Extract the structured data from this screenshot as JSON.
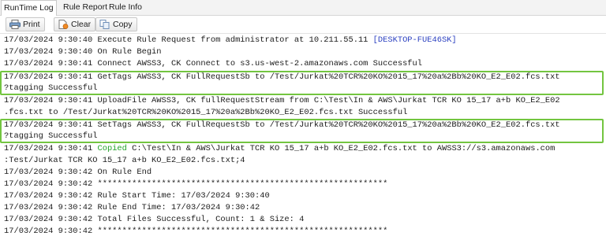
{
  "tabs": [
    {
      "label": "RunTime Log",
      "active": true
    },
    {
      "label": "Rule Report",
      "active": false
    },
    {
      "label": "Rule Info",
      "active": false
    }
  ],
  "toolbar": {
    "print_label": "Print",
    "clear_label": "Clear",
    "copy_label": "Copy"
  },
  "colors": {
    "highlight_border": "#73c540",
    "link_blue": "#2a3fc0",
    "copied_green": "#21a327"
  },
  "log": {
    "lines": [
      {
        "text": "17/03/2024 9:30:40 Execute Rule Request from administrator at 10.211.55.11 ",
        "suffix": "[DESKTOP-FUE46SK]"
      },
      {
        "text": "17/03/2024 9:30:40 On Rule Begin"
      },
      {
        "text": "17/03/2024 9:30:41 Connect AWSS3, CK Connect to s3.us-west-2.amazonaws.com Successful"
      },
      {
        "text": "17/03/2024 9:30:41 GetTags AWSS3, CK FullRequestSb to /Test/Jurkat%20TCR%20KO%2015_17%20a%2Bb%20KO_E2_E02.fcs.txt"
      },
      {
        "text": "?tagging Successful"
      },
      {
        "text": "17/03/2024 9:30:41 UploadFile AWSS3, CK fullRequestStream from C:\\Test\\In & AWS\\Jurkat TCR KO 15_17 a+b KO_E2_E02"
      },
      {
        "text": ".fcs.txt to /Test/Jurkat%20TCR%20KO%2015_17%20a%2Bb%20KO_E2_E02.fcs.txt Successful"
      },
      {
        "text": "17/03/2024 9:30:41 SetTags AWSS3, CK FullRequestSb to /Test/Jurkat%20TCR%20KO%2015_17%20a%2Bb%20KO_E2_E02.fcs.txt"
      },
      {
        "text": "?tagging Successful"
      },
      {
        "prefix": "17/03/2024 9:30:41 ",
        "highlight": "Copied",
        "text": " C:\\Test\\In & AWS\\Jurkat TCR KO 15_17 a+b KO_E2_E02.fcs.txt to AWSS3://s3.amazonaws.com"
      },
      {
        "text": ":Test/Jurkat TCR KO 15_17 a+b KO_E2_E02.fcs.txt;4"
      },
      {
        "text": "17/03/2024 9:30:42 On Rule End"
      },
      {
        "text": "17/03/2024 9:30:42 ***********************************************************"
      },
      {
        "text": "17/03/2024 9:30:42 Rule Start Time: 17/03/2024 9:30:40"
      },
      {
        "text": "17/03/2024 9:30:42 Rule End Time: 17/03/2024 9:30:42"
      },
      {
        "text": "17/03/2024 9:30:42 Total Files Successful, Count: 1 & Size: 4"
      },
      {
        "text": "17/03/2024 9:30:42 ***********************************************************"
      }
    ]
  }
}
